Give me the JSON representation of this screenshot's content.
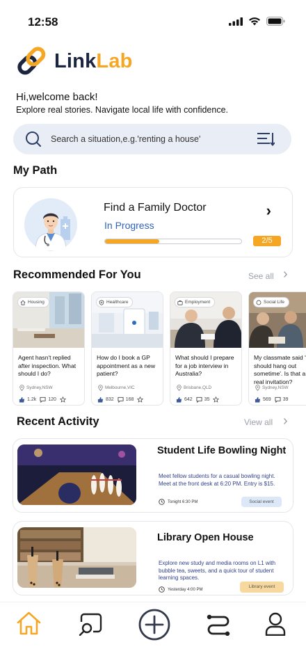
{
  "status_bar": {
    "time": "12:58"
  },
  "app": {
    "name_part1": "Link",
    "name_part2": "Lab"
  },
  "welcome": {
    "greeting": "Hi,welcome back!",
    "subtitle": "Explore real stories. Navigate local life with confidence."
  },
  "search": {
    "placeholder": "Search a situation,e.g.'renting a house'"
  },
  "my_path": {
    "section_title": "My Path",
    "card": {
      "title": "Find a Family Doctor",
      "status": "In Progress",
      "progress_label": "2/5",
      "progress_fraction": 0.4
    }
  },
  "recommended": {
    "section_title": "Recommended For You",
    "see_all": "See all",
    "cards": [
      {
        "tag": "Housing",
        "text": "Agent hasn't replied after inspection. What should I do?",
        "location": "Sydney,NSW",
        "likes": "1.2k",
        "comments": "120"
      },
      {
        "tag": "Healthcare",
        "text": "How do I book a GP appointment as a new patient?",
        "location": "Melbourne,VIC",
        "likes": "832",
        "comments": "168"
      },
      {
        "tag": "Employment",
        "text": "What should I prepare for a job interview in Australia?",
        "location": "Brisbane,QLD",
        "likes": "642",
        "comments": "35"
      },
      {
        "tag": "Social Life",
        "text": "My classmate said 'we should hang out sometime'. Is that a real invitation?",
        "location": "Sydney,NSW",
        "likes": "569",
        "comments": "39"
      }
    ]
  },
  "recent": {
    "section_title": "Recent Activity",
    "view_all": "View all",
    "items": [
      {
        "title": "Student Life Bowling Night",
        "description": "Meet fellow students for a casual bowling night. Meet at the front desk at 6:20 PM. Entry is $15.",
        "time": "Tonight  6:30 PM",
        "badge": "Social event",
        "badge_color": "#dce8f7"
      },
      {
        "title": "Library Open House",
        "description": "Explore new study and media rooms on L1 with bubble tea, sweets, and a quick tour of student learning spaces.",
        "time": "Yesterday  4:00 PM",
        "badge": "Library event",
        "badge_color": "#f7d9a0"
      }
    ]
  },
  "tabbar": {
    "items": [
      "home-icon",
      "search-stories-icon",
      "add-icon",
      "route-icon",
      "profile-icon"
    ],
    "active_color": "#f5a623"
  },
  "colors": {
    "accent": "#f5a623",
    "brand_dark": "#1c2540",
    "link_blue": "#2f62b8"
  }
}
